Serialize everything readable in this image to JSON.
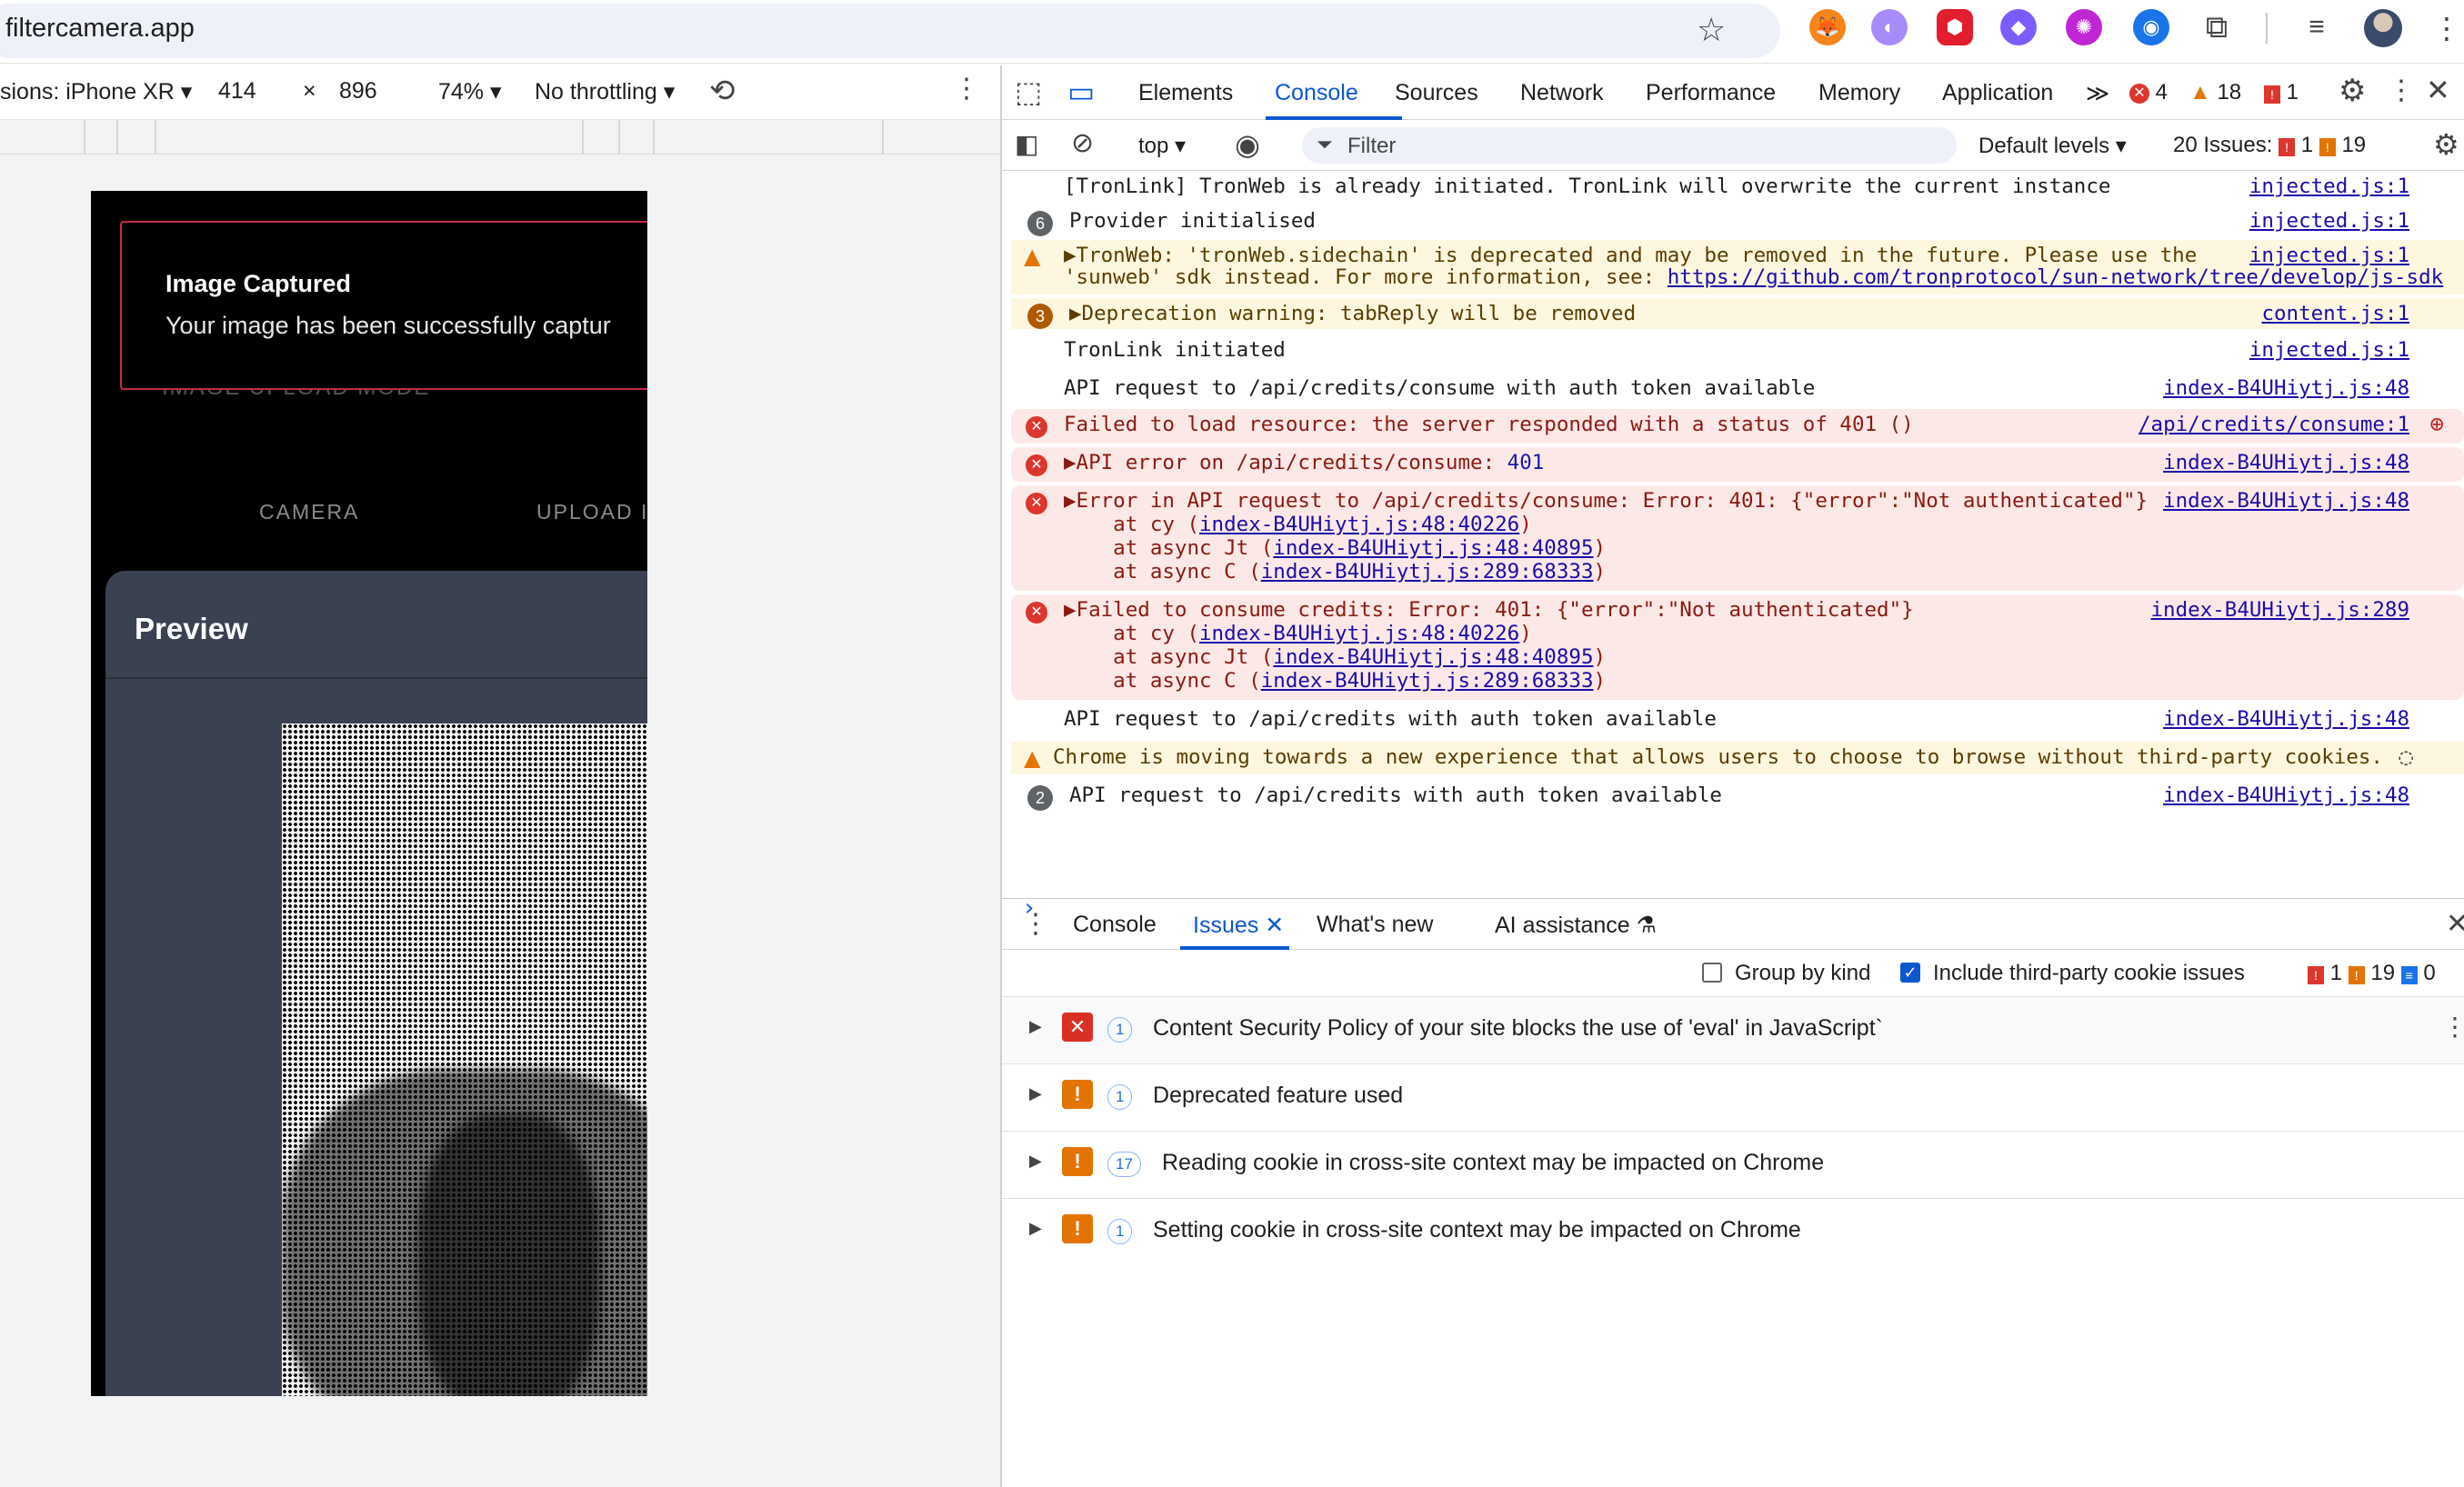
{
  "browser": {
    "url": "filtercamera.app"
  },
  "device_toolbar": {
    "dimensions_label": "sions: iPhone XR ▾",
    "width": "414",
    "times": "×",
    "height": "896",
    "zoom": "74% ▾",
    "throttling": "No throttling ▾"
  },
  "phone": {
    "ghost_text": "IMAGE UPLOAD MODE",
    "toast_title": "Image Captured",
    "toast_message": "Your image has been successfully captur",
    "tab_camera": "CAMERA",
    "tab_upload": "UPLOAD I",
    "preview_title": "Preview"
  },
  "devtools": {
    "tabs": [
      "Elements",
      "Console",
      "Sources",
      "Network",
      "Performance",
      "Memory",
      "Application"
    ],
    "more_tabs": "≫",
    "errors_count": "4",
    "warnings_count": "18",
    "issues_count": "1",
    "context": "top ▾",
    "filter_placeholder": "Filter",
    "levels": "Default levels ▾",
    "issues_label": "20 Issues:",
    "issues_red": "1",
    "issues_orange": "19"
  },
  "console": {
    "rows": [
      {
        "text": "[TronLink] TronWeb is already initiated. TronLink will overwrite the current instance",
        "src": "injected.js:1"
      },
      {
        "count": "6",
        "text": "Provider initialised",
        "src": "injected.js:1"
      },
      {
        "text1": "▶TronWeb: 'tronWeb.sidechain' is deprecated and may be removed in the future. Please use the",
        "text2": "'sunweb' sdk instead. For more information, see: ",
        "link": "https://github.com/tronprotocol/sun-network/tree/develop/js-sdk",
        "src": "injected.js:1"
      },
      {
        "count": "3",
        "text": "▶Deprecation warning: tabReply will be removed",
        "src": "content.js:1"
      },
      {
        "text": "TronLink initiated",
        "src": "injected.js:1"
      },
      {
        "text": "API request to /api/credits/consume with auth token available",
        "src": "index-B4UHiytj.js:48"
      },
      {
        "text": "Failed to load resource: the server responded with a status of 401 ()",
        "src": "/api/credits/consume:1"
      },
      {
        "text": "▶API error on /api/credits/consume: ",
        "num": "401",
        "src": "index-B4UHiytj.js:48"
      },
      {
        "text": "▶Error in API request to /api/credits/consume: Error: 401: {\"error\":\"Not authenticated\"}",
        "src": "index-B4UHiytj.js:48",
        "stack": [
          {
            "pre": "    at cy (",
            "link": "index-B4UHiytj.js:48:40226",
            "post": ")"
          },
          {
            "pre": "    at async Jt (",
            "link": "index-B4UHiytj.js:48:40895",
            "post": ")"
          },
          {
            "pre": "    at async C (",
            "link": "index-B4UHiytj.js:289:68333",
            "post": ")"
          }
        ]
      },
      {
        "text": "▶Failed to consume credits: Error: 401: {\"error\":\"Not authenticated\"}",
        "src": "index-B4UHiytj.js:289",
        "stack": [
          {
            "pre": "    at cy (",
            "link": "index-B4UHiytj.js:48:40226",
            "post": ")"
          },
          {
            "pre": "    at async Jt (",
            "link": "index-B4UHiytj.js:48:40895",
            "post": ")"
          },
          {
            "pre": "    at async C (",
            "link": "index-B4UHiytj.js:289:68333",
            "post": ")"
          }
        ]
      },
      {
        "text": "API request to /api/credits with auth token available",
        "src": "index-B4UHiytj.js:48"
      },
      {
        "text": "Chrome is moving towards a new experience that allows users to choose to browse without third-party cookies."
      },
      {
        "count": "2",
        "text": "API request to /api/credits with auth token available",
        "src": "index-B4UHiytj.js:48"
      }
    ],
    "prompt": "›"
  },
  "drawer": {
    "tabs": [
      "Console",
      "Issues",
      "What's new",
      "AI assistance"
    ],
    "group_by_kind": "Group by kind",
    "include_third_party": "Include third-party cookie issues",
    "counts": {
      "red": "1",
      "orange": "19",
      "blue": "0"
    },
    "issues": [
      {
        "kind": "red",
        "count": "1",
        "title": "Content Security Policy of your site blocks the use of 'eval' in JavaScript`"
      },
      {
        "kind": "orange",
        "count": "1",
        "title": "Deprecated feature used"
      },
      {
        "kind": "orange",
        "count": "17",
        "title": "Reading cookie in cross-site context may be impacted on Chrome"
      },
      {
        "kind": "orange",
        "count": "1",
        "title": "Setting cookie in cross-site context may be impacted on Chrome"
      }
    ]
  }
}
